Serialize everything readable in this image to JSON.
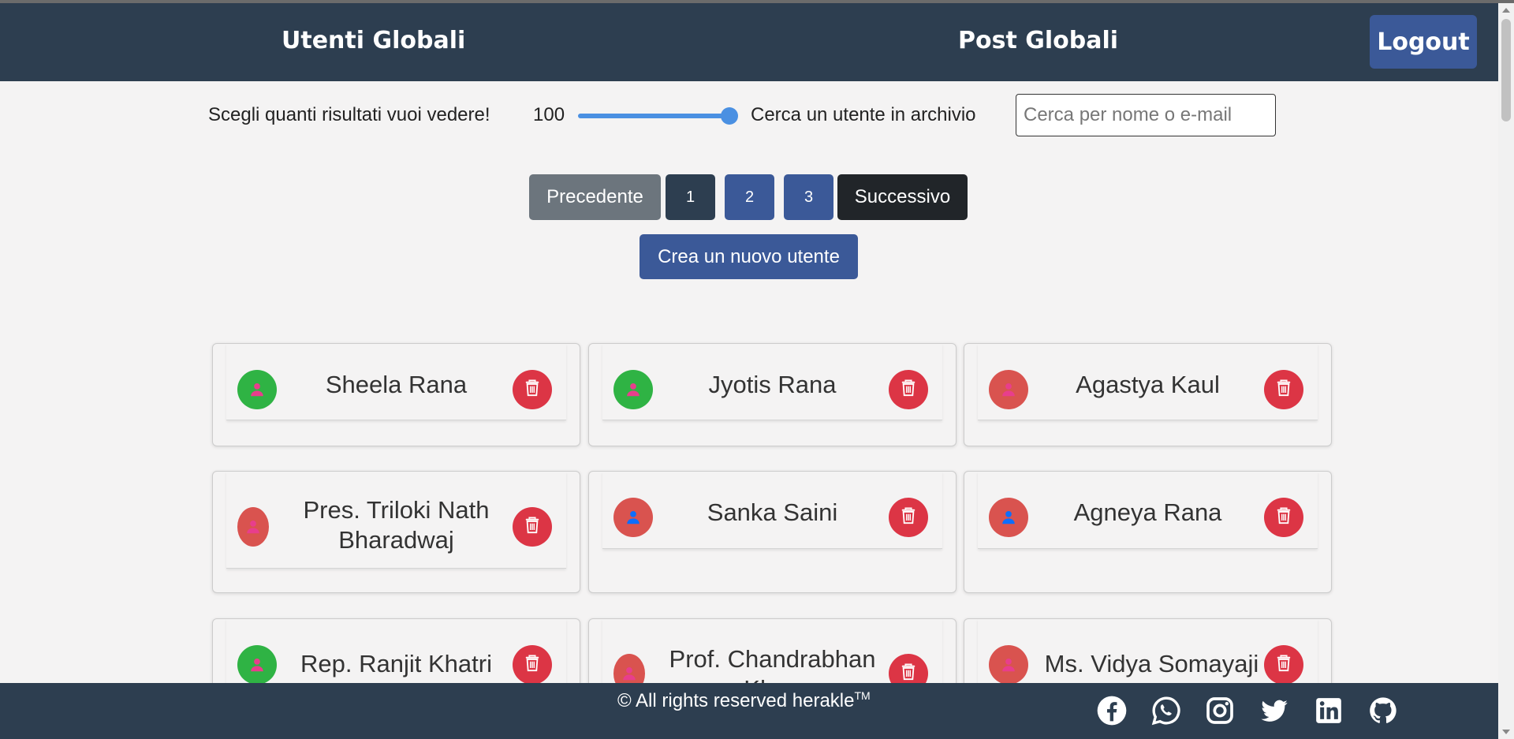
{
  "header": {
    "nav_users": "Utenti Globali",
    "nav_posts": "Post Globali",
    "logout": "Logout"
  },
  "controls": {
    "results_label": "Scegli quanti risultati vuoi vedere!",
    "results_value": "100",
    "slider_fraction": 1.0,
    "search_label": "Cerca un utente in archivio",
    "search_placeholder": "Cerca per nome o e-mail"
  },
  "pagination": {
    "prev": "Precedente",
    "pages": [
      "1",
      "2",
      "3"
    ],
    "current_page": "1",
    "next": "Successivo"
  },
  "create_user": "Crea un nuovo utente",
  "users": [
    {
      "name": "Sheela Rana",
      "avatar_bg": "#2fb344",
      "icon_color": "#e83e8c",
      "gender": "female"
    },
    {
      "name": "Jyotis Rana",
      "avatar_bg": "#2fb344",
      "icon_color": "#e83e8c",
      "gender": "female"
    },
    {
      "name": "Agastya Kaul",
      "avatar_bg": "#d9534f",
      "icon_color": "#e83e8c",
      "gender": "female"
    },
    {
      "name": "Pres. Triloki Nath Bharadwaj",
      "avatar_bg": "#d9534f",
      "icon_color": "#e83e8c",
      "gender": "female"
    },
    {
      "name": "Sanka Saini",
      "avatar_bg": "#d9534f",
      "icon_color": "#0d6efd",
      "gender": "male"
    },
    {
      "name": "Agneya Rana",
      "avatar_bg": "#d9534f",
      "icon_color": "#0d6efd",
      "gender": "male"
    },
    {
      "name": "Rep. Ranjit Khatri",
      "avatar_bg": "#2fb344",
      "icon_color": "#e83e8c",
      "gender": "female"
    },
    {
      "name": "Prof. Chandrabhan Khan",
      "avatar_bg": "#d9534f",
      "icon_color": "#e83e8c",
      "gender": "female"
    },
    {
      "name": "Ms. Vidya Somayaji",
      "avatar_bg": "#d9534f",
      "icon_color": "#e83e8c",
      "gender": "female"
    }
  ],
  "footer": {
    "copyright": "© All rights reserved herakle",
    "trademark": "TM",
    "social_icons": [
      "facebook-icon",
      "whatsapp-icon",
      "instagram-icon",
      "twitter-icon",
      "linkedin-icon",
      "github-icon"
    ]
  },
  "colors": {
    "navbar": "#2d3e50",
    "primary": "#3b5998",
    "danger": "#dc3545",
    "slider": "#4a90e2"
  }
}
